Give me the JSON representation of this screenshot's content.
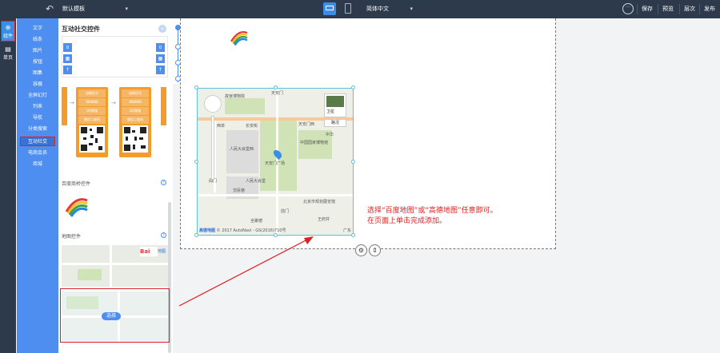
{
  "topbar": {
    "template_label": "默认模板",
    "language_label": "简体中文",
    "more_icon": "more-icon",
    "buttons": [
      "保存",
      "预览",
      "层次",
      "发布"
    ]
  },
  "rail": {
    "items": [
      {
        "label": "组件",
        "icon": "plus-icon",
        "active": true
      },
      {
        "label": "单页",
        "icon": "page-icon",
        "active": false
      }
    ]
  },
  "categories": [
    "文字",
    "线条",
    "图片",
    "按钮",
    "图集",
    "容器",
    "全屏幻灯",
    "列表",
    "导航",
    "分类搜索",
    "互动社交",
    "电商会员",
    "商城"
  ],
  "active_category": "互动社交",
  "panel": {
    "title": "互动社交控件",
    "close_icon": "collapse-icon",
    "social_rows": [
      "加微信号",
      "888888",
      "QQ客服",
      "微信二维码"
    ],
    "baidu_section": "百度商桥控件",
    "map_section": "地图控件",
    "baidu_logo_text": "Bai",
    "baidu_map_text": "地图",
    "select_label": "选择"
  },
  "map": {
    "labels": [
      "西单",
      "长安街",
      "天安门西",
      "天安门广场",
      "人民大会堂",
      "前门",
      "故宫博物院",
      "卫星",
      "路况",
      "中国国家博物馆",
      "北京市规划展览馆",
      "劳动人民文化宫",
      "王府井",
      "国家大剧院",
      "全聚德",
      "交民巷",
      "阎门",
      "天安门",
      "中华",
      "人民大会堂西"
    ],
    "copyright": "© 2017 AutoNavi - GS(2016)710号",
    "logo_text": "高德地图",
    "brand_right": "广东"
  },
  "note_lines": [
    "选择“百度地图”或“高德地图”任意即可。",
    "在页面上单击完成添加。"
  ],
  "colors": {
    "topbar_bg": "#2d3a4b",
    "accent": "#3a8ee6",
    "category_bg": "#4d8ef0",
    "orange": "#f39c2a",
    "highlight_red": "#e02020"
  }
}
